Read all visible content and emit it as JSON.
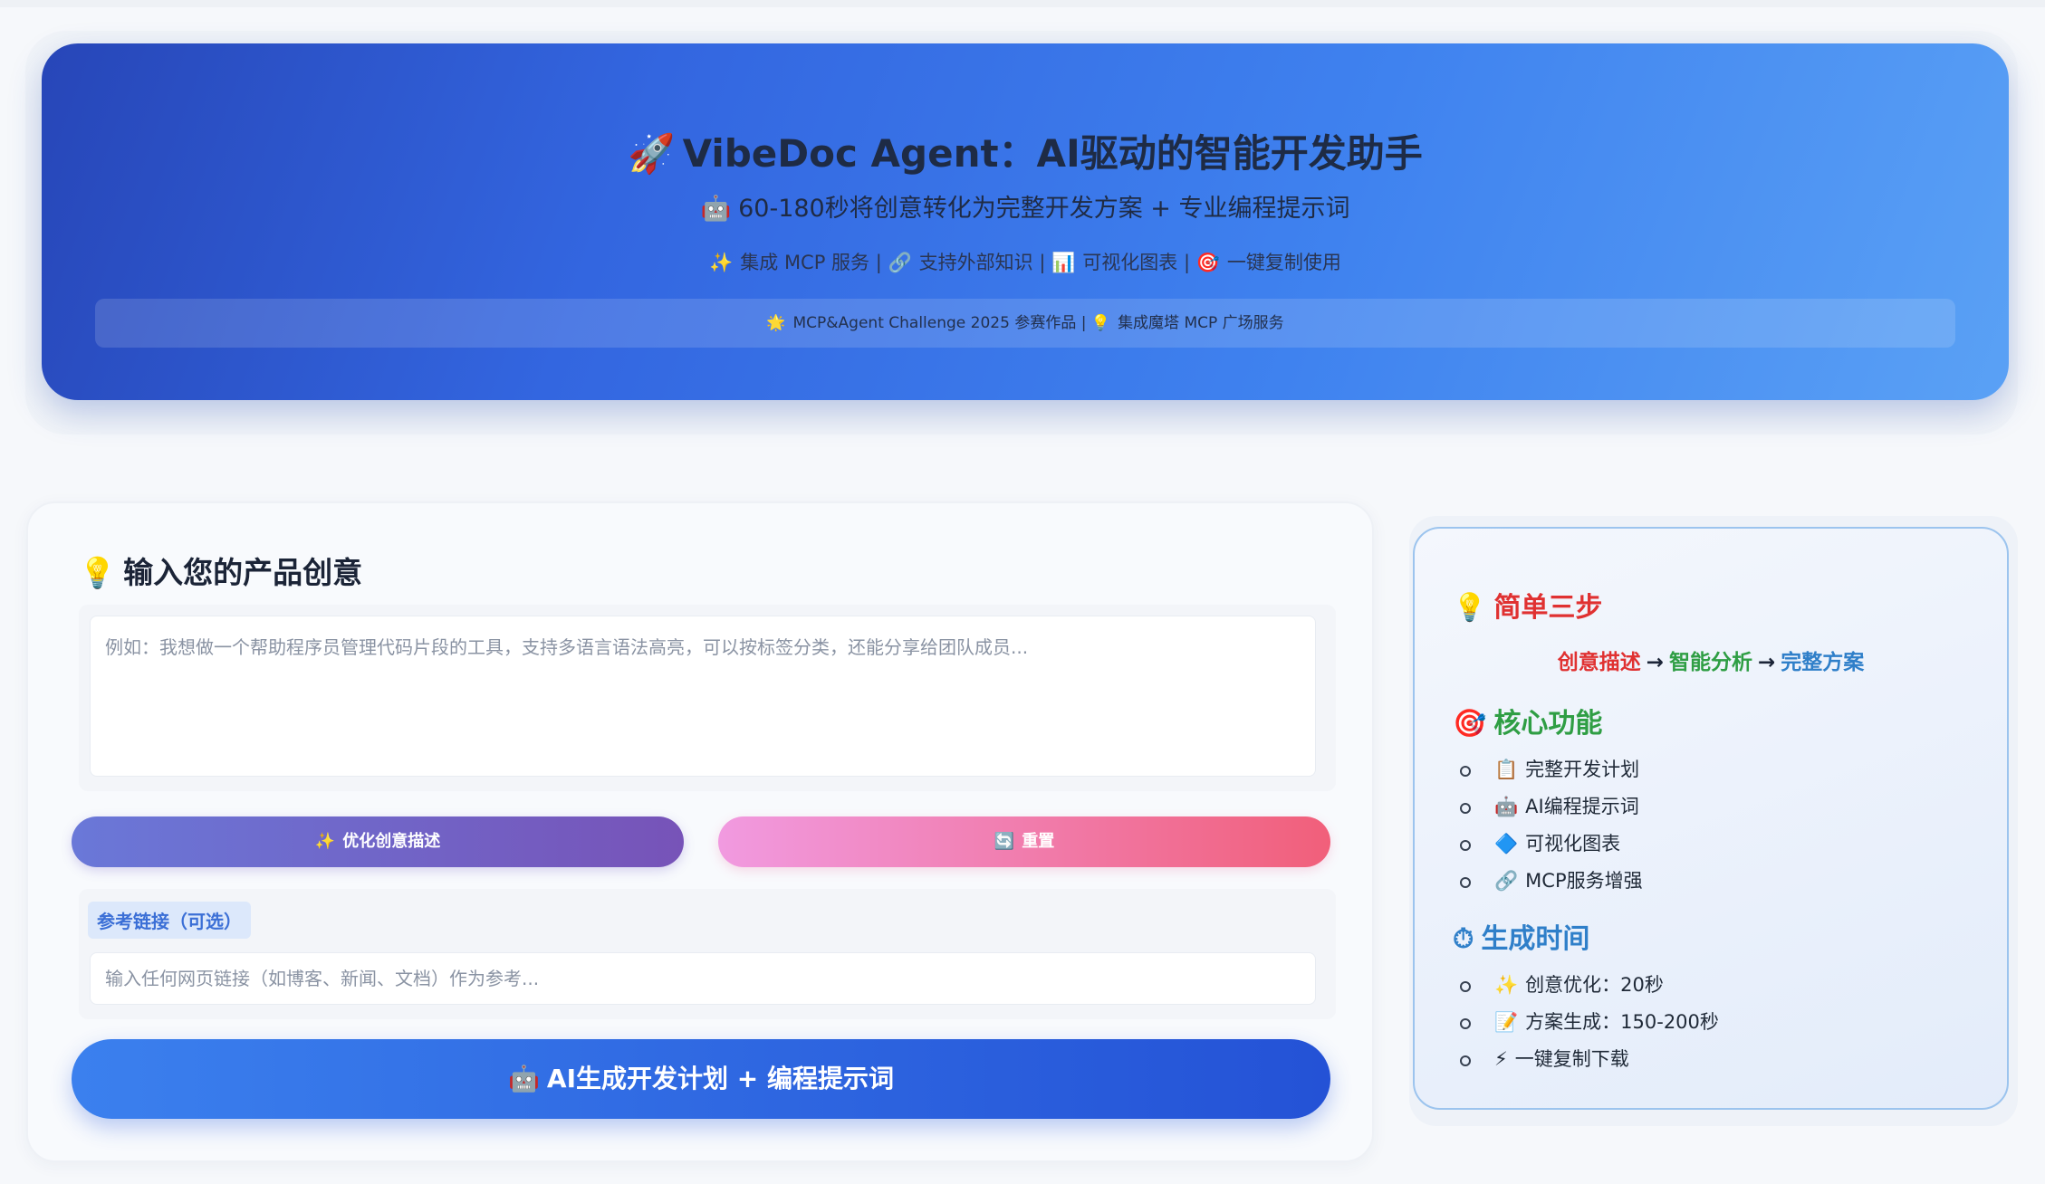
{
  "hero": {
    "title_icon": "rocket-icon",
    "title_emoji": "🚀",
    "title": "VibeDoc Agent：AI驱动的智能开发助手",
    "subtitle_emoji": "🤖",
    "subtitle": "60-180秒将创意转化为完整开发方案 + 专业编程提示词",
    "features": [
      {
        "emoji": "✨",
        "icon": "sparkles-icon",
        "label": "集成 MCP 服务"
      },
      {
        "emoji": "🔗",
        "icon": "link-icon",
        "label": "支持外部知识"
      },
      {
        "emoji": "📊",
        "icon": "bar-chart-icon",
        "label": "可视化图表"
      },
      {
        "emoji": "🎯",
        "icon": "target-icon",
        "label": "一键复制使用"
      }
    ],
    "separator": "|",
    "banner": {
      "left_emoji": "🌟",
      "left": "MCP&Agent Challenge 2025 参赛作品",
      "right_emoji": "💡",
      "right": "集成魔塔 MCP 广场服务"
    }
  },
  "input_card": {
    "title_emoji": "💡",
    "title": "输入您的产品创意",
    "idea_placeholder": "例如：我想做一个帮助程序员管理代码片段的工具，支持多语言语法高亮，可以按标签分类，还能分享给团队成员...",
    "optimize_button_emoji": "✨",
    "optimize_button": "优化创意描述",
    "reset_button_emoji": "🔄",
    "reset_button": "重置",
    "reference_label": "参考链接（可选）",
    "reference_placeholder": "输入任何网页链接（如博客、新闻、文档）作为参考...",
    "generate_button_emoji": "🤖",
    "generate_button": "AI生成开发计划 + 编程提示词"
  },
  "side_card": {
    "steps_title_emoji": "💡",
    "steps_title": "简单三步",
    "flow": [
      "创意描述",
      "智能分析",
      "完整方案"
    ],
    "flow_arrow": "→",
    "features_title_emoji": "🎯",
    "features_title": "核心功能",
    "features": [
      {
        "emoji": "📋",
        "label": "完整开发计划"
      },
      {
        "emoji": "🤖",
        "label": "AI编程提示词"
      },
      {
        "emoji": "🔷",
        "label": "可视化图表"
      },
      {
        "emoji": "🔗",
        "label": "MCP服务增强"
      }
    ],
    "time_title_emoji": "⏱",
    "time_title": "生成时间",
    "times": [
      {
        "emoji": "✨",
        "label": "创意优化：20秒"
      },
      {
        "emoji": "📝",
        "label": "方案生成：150-200秒"
      },
      {
        "emoji": "⚡",
        "label": "一键复制下载"
      }
    ]
  },
  "colors": {
    "hero_gradient": [
      "#2746b8",
      "#5aa1f5"
    ],
    "optimize_gradient": [
      "#6a78d8",
      "#7753b8"
    ],
    "reset_gradient": [
      "#f19ae0",
      "#f15f7a"
    ],
    "generate_gradient": [
      "#3b80ee",
      "#2452d6"
    ],
    "accent_red": "#e03131",
    "accent_green": "#2f9e44",
    "accent_blue": "#2f7fc9"
  }
}
